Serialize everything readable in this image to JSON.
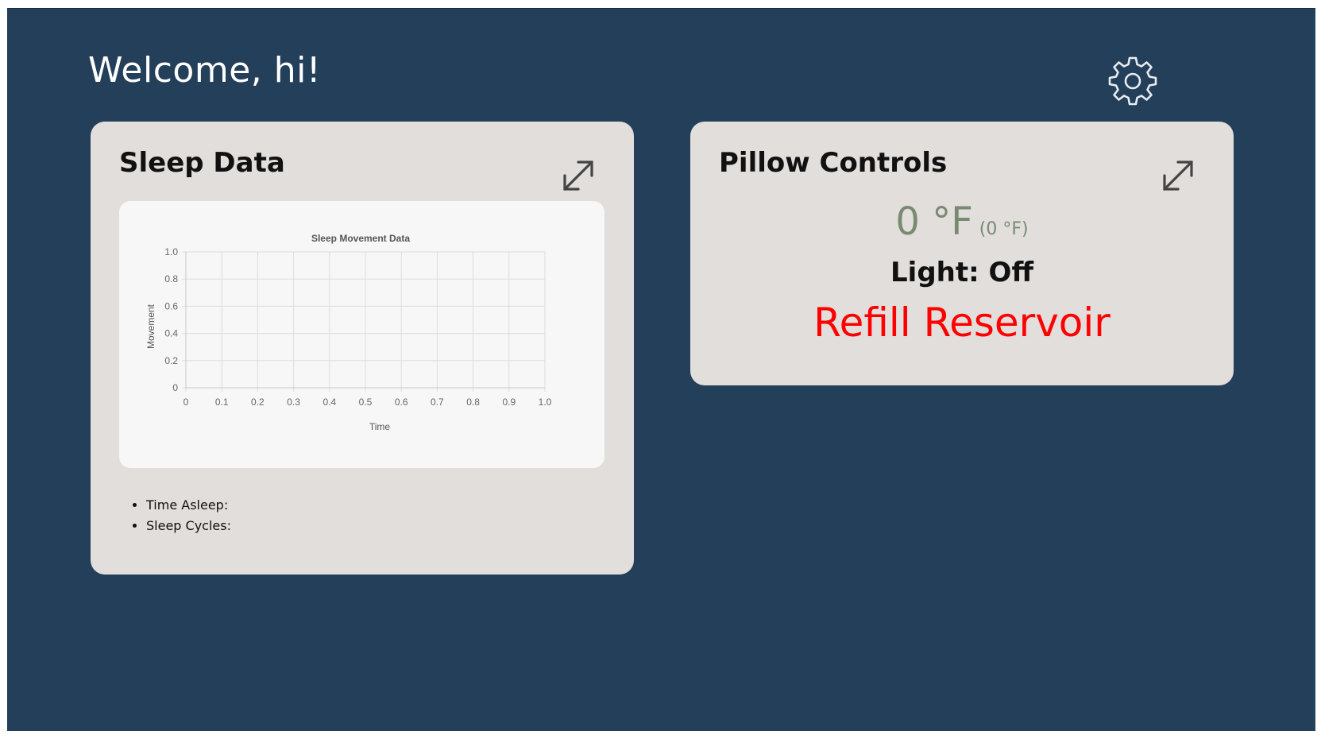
{
  "header": {
    "welcome_text": "Welcome, hi!",
    "settings_icon": "gear-icon"
  },
  "sleep_card": {
    "title": "Sleep Data",
    "expand_icon": "expand-arrows-icon",
    "stats": [
      {
        "label": "Time Asleep:"
      },
      {
        "label": "Sleep Cycles:"
      }
    ]
  },
  "pillow_card": {
    "title": "Pillow Controls",
    "expand_icon": "expand-arrows-icon",
    "temperature": "0 °F",
    "temperature_sub": "(0 °F)",
    "light_status": "Light: Off",
    "refill_text": "Refill Reservoir"
  },
  "colors": {
    "background": "#243f5a",
    "card": "#e1dedb",
    "chart_panel": "#f7f7f7",
    "temperature": "#7a8a72",
    "alert": "#ff0000"
  },
  "chart_data": {
    "type": "line",
    "title": "Sleep Movement Data",
    "xlabel": "Time",
    "ylabel": "Movement",
    "xlim": [
      0,
      1
    ],
    "ylim": [
      0,
      1
    ],
    "x_ticks": [
      "0",
      "0.1",
      "0.2",
      "0.3",
      "0.4",
      "0.5",
      "0.6",
      "0.7",
      "0.8",
      "0.9",
      "1.0"
    ],
    "y_ticks": [
      "0",
      "0.2",
      "0.4",
      "0.6",
      "0.8",
      "1.0"
    ],
    "series": [],
    "grid": true
  }
}
